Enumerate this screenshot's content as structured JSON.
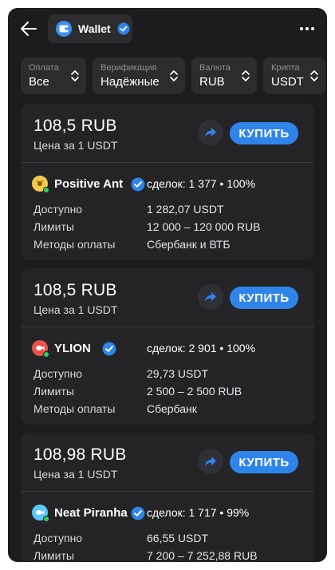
{
  "header": {
    "title": "Wallet",
    "back_icon": "arrow-left-icon",
    "more_icon": "ellipsis-icon"
  },
  "filters": [
    {
      "label": "Оплата",
      "value": "Все"
    },
    {
      "label": "Верификация",
      "value": "Надёжные"
    },
    {
      "label": "Валюта",
      "value": "RUB"
    },
    {
      "label": "Крипта",
      "value": "USDT"
    }
  ],
  "labels": {
    "available": "Доступно",
    "limits": "Лимиты",
    "methods": "Методы оплаты",
    "buy": "КУПИТЬ"
  },
  "offers": [
    {
      "price": "108,5 RUB",
      "price_sub": "Цена за 1 USDT",
      "seller": "Positive Ant",
      "deals": "сделок: 1 377 • 100%",
      "available": "1 282,07 USDT",
      "limits": "12 000 – 120 000 RUB",
      "methods": "Сбербанк и ВТБ",
      "avatar_color": "#f2c94c"
    },
    {
      "price": "108,5 RUB",
      "price_sub": "Цена за 1 USDT",
      "seller": "YLION",
      "deals": "сделок: 2 901 • 100%",
      "available": "29,73 USDT",
      "limits": "2 500 – 2 500 RUB",
      "methods": "Сбербанк",
      "avatar_color": "#e8524a"
    },
    {
      "price": "108,98 RUB",
      "price_sub": "Цена за 1 USDT",
      "seller": "Neat Piranha",
      "deals": "сделок: 1 717 • 99%",
      "available": "66,55 USDT",
      "limits": "7 200 – 7 252,88 RUB",
      "methods": "",
      "avatar_color": "#5ac8fa"
    }
  ],
  "colors": {
    "accent": "#2f84ea",
    "background": "#1c1c1e",
    "card": "#242426",
    "online": "#30d158"
  }
}
